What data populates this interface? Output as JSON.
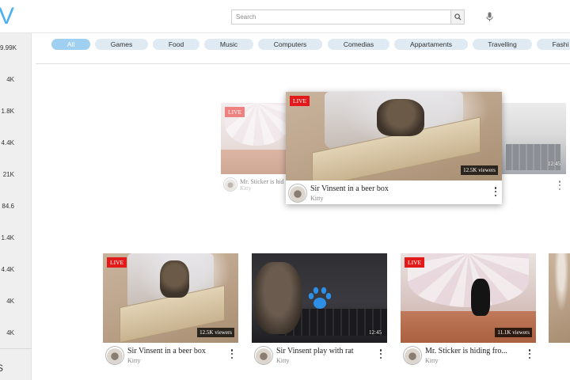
{
  "header": {
    "logo": "V",
    "search_placeholder": "Search",
    "search_icon": "search-icon",
    "mic_icon": "mic-icon"
  },
  "sidebar": {
    "counts": [
      "9.99K",
      "4K",
      "1.8K",
      "4.4K",
      "21K",
      "84.6",
      "1.4K",
      "4.4K",
      "4K",
      "4K"
    ],
    "bottom_label": "S"
  },
  "chips": [
    "All",
    "Games",
    "Food",
    "Music",
    "Computers",
    "Comedias",
    "Appartaments",
    "Travelling",
    "Fashi"
  ],
  "active_chip": "All",
  "carousel": {
    "left": {
      "title": "Mr. Sticker is hid",
      "channel": "Kitty",
      "live": "LIVE"
    },
    "center": {
      "title": "Sir Vinsent in a beer box",
      "channel": "Kitty",
      "live": "LIVE",
      "viewers": "12.5K viewers"
    },
    "right": {
      "duration": "12:45"
    }
  },
  "grid": [
    {
      "title": "Sir Vinsent in a beer box",
      "channel": "Kitty",
      "live": "LIVE",
      "viewers": "12.5K viewers"
    },
    {
      "title": "Sir Vinsent play with rat",
      "channel": "Kitty",
      "duration": "12:45"
    },
    {
      "title": "Mr. Sticker is hiding fro...",
      "channel": "Kitty",
      "live": "LIVE",
      "viewers": "11.1K viewers"
    }
  ],
  "colors": {
    "accent": "#4ab0f0",
    "chip_active": "#9fd0f2",
    "chip": "#dfeaf3",
    "live": "#e31a1a",
    "paw": "#2e8fe6"
  }
}
